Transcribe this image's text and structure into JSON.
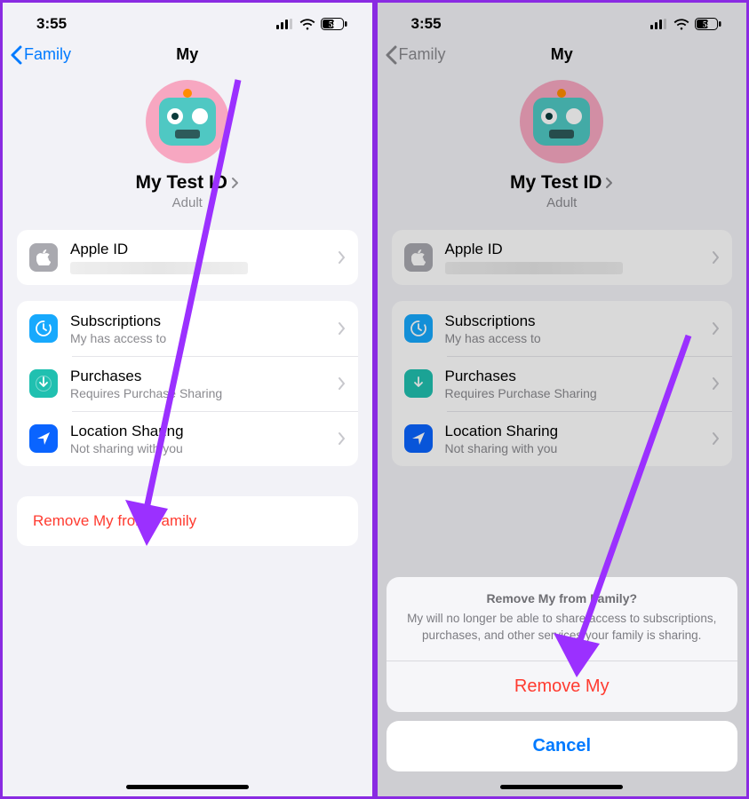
{
  "status": {
    "time": "3:55",
    "battery": "58"
  },
  "nav": {
    "back": "Family",
    "title": "My"
  },
  "profile": {
    "name": "My Test ID",
    "role": "Adult"
  },
  "apple_id": {
    "label": "Apple ID"
  },
  "items": {
    "subscriptions": {
      "label": "Subscriptions",
      "sub": "My has access to"
    },
    "purchases": {
      "label": "Purchases",
      "sub": "Requires Purchase Sharing"
    },
    "location": {
      "label": "Location Sharing",
      "sub": "Not sharing with you"
    }
  },
  "remove": {
    "label": "Remove My from Family"
  },
  "sheet": {
    "title": "Remove My from Family?",
    "desc": "My will no longer be able to share access to subscriptions, purchases, and other services your family is sharing.",
    "action": "Remove My",
    "cancel": "Cancel"
  }
}
